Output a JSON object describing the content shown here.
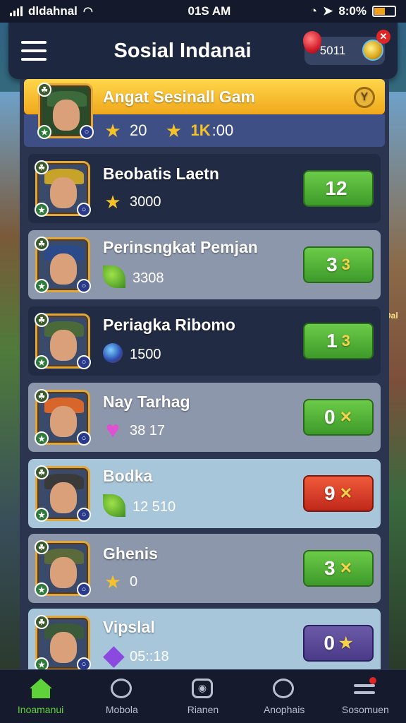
{
  "status_bar": {
    "carrier": "dldahnal",
    "time": "01S AM",
    "battery_text": "8:0%"
  },
  "header": {
    "title": "Sosial Indanai",
    "currency_value": "5011",
    "menu_icon": "hamburger-icon"
  },
  "featured": {
    "title": "Angat Sesinall Gam",
    "stat_a": "20",
    "stat_b": "1K",
    "stat_c": ":00"
  },
  "rows": [
    {
      "name": "Beobatis Laetn",
      "stat": "3000",
      "stat_icon": "star-icon",
      "score": "12",
      "score_mark": "",
      "score_color": "green",
      "style": "dark"
    },
    {
      "name": "Perinsngkat Pemjan",
      "stat": "3308",
      "stat_icon": "leaf-icon",
      "score": "3",
      "score_mark": "3",
      "score_color": "green",
      "style": "light"
    },
    {
      "name": "Periagka Ribomo",
      "stat": "1500",
      "stat_icon": "orb-icon",
      "score": "1",
      "score_mark": "3",
      "score_color": "green",
      "style": "dark"
    },
    {
      "name": "Nay Tarhag",
      "stat": "38 17",
      "stat_icon": "heart-icon",
      "score": "0",
      "score_mark": "✕",
      "score_color": "green",
      "style": "light"
    },
    {
      "name": "Bodka",
      "stat": "12 510",
      "stat_icon": "leaf-icon",
      "score": "9",
      "score_mark": "✕",
      "score_color": "red",
      "style": "blue"
    },
    {
      "name": "Ghenis",
      "stat": "0",
      "stat_icon": "star-icon",
      "score": "3",
      "score_mark": "✕",
      "score_color": "green",
      "style": "light"
    },
    {
      "name": "Vipslal",
      "stat": "05::18",
      "stat_icon": "crystal-icon",
      "score": "0",
      "score_mark": "★",
      "score_color": "purple",
      "style": "blue"
    }
  ],
  "nav": [
    {
      "label": "Inoamanui",
      "active": true
    },
    {
      "label": "Mobola",
      "active": false
    },
    {
      "label": "Rianen",
      "active": false
    },
    {
      "label": "Anophais",
      "active": false
    },
    {
      "label": "Sosomuen",
      "active": false
    }
  ],
  "colors": {
    "accent_green": "#5fd23a",
    "featured_gold": "#f0a81c",
    "score_red": "#c0281a",
    "panel": "#2c3550"
  },
  "side_label": "Dal"
}
